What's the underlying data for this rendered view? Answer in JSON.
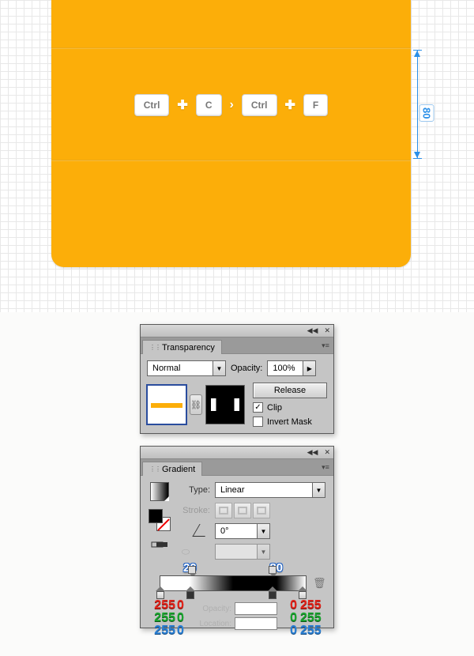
{
  "canvas": {
    "measure_value": "80",
    "shortcut": {
      "k1": "Ctrl",
      "k2": "C",
      "k3": "Ctrl",
      "k4": "F",
      "plus": "✚",
      "chev": "›"
    }
  },
  "transparency": {
    "tab_label": "Transparency",
    "blend_mode": "Normal",
    "opacity_label": "Opacity:",
    "opacity_value": "100%",
    "release_btn": "Release",
    "clip_label": "Clip",
    "clip_checked": "✓",
    "invert_label": "Invert Mask"
  },
  "gradient": {
    "tab_label": "Gradient",
    "type_label": "Type:",
    "type_value": "Linear",
    "stroke_label": "Stroke:",
    "angle_value": "0°",
    "loc_20": "20",
    "loc_80": "80",
    "opacity_label": "Opacity:",
    "location_label": "Location:",
    "rgb_white": {
      "r": "255",
      "g": "255",
      "b": "255"
    },
    "rgb_black": {
      "r": "0",
      "g": "0",
      "b": "0"
    }
  }
}
